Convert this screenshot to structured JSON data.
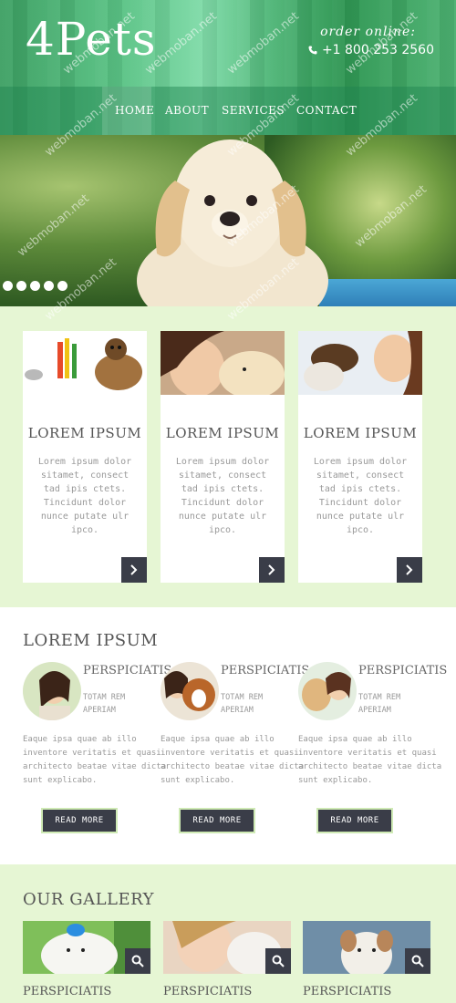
{
  "header": {
    "logo": "4Pets",
    "order_label": "order online:",
    "phone": "+1 800 253 2560"
  },
  "nav": {
    "items": [
      {
        "label": "HOME"
      },
      {
        "label": "ABOUT"
      },
      {
        "label": "SERVICES"
      },
      {
        "label": "CONTACT"
      }
    ],
    "active": "HOME"
  },
  "hero": {
    "slide_count": 5
  },
  "features": {
    "cards": [
      {
        "title": "LOREM IPSUM",
        "desc": "Lorem ipsum dolor sitamet, consect tad ipis ctets. Tincidunt dolor nunce putate ulr ipco."
      },
      {
        "title": "LOREM IPSUM",
        "desc": "Lorem ipsum dolor sitamet, consect tad ipis ctets. Tincidunt dolor nunce putate ulr ipco."
      },
      {
        "title": "LOREM IPSUM",
        "desc": "Lorem ipsum dolor sitamet, consect tad ipis ctets. Tincidunt dolor nunce putate ulr ipco."
      }
    ]
  },
  "about": {
    "title": "LOREM IPSUM",
    "people": [
      {
        "title": "PERSPICIATIS",
        "sub": "TOTAM REM APERIAM",
        "desc": "Eaque ipsa quae ab illo inventore veritatis et quasi architecto beatae vitae dicta sunt explicabo.",
        "button": "READ MORE"
      },
      {
        "title": "PERSPICIATIS",
        "sub": "TOTAM REM APERIAM",
        "desc": "Eaque ipsa quae ab illo inventore veritatis et quasi architecto beatae vitae dicta sunt explicabo.",
        "button": "READ MORE"
      },
      {
        "title": "PERSPICIATIS",
        "sub": "TOTAM REM APERIAM",
        "desc": "Eaque ipsa quae ab illo inventore veritatis et quasi architecto beatae vitae dicta sunt explicabo.",
        "button": "READ MORE"
      }
    ]
  },
  "gallery": {
    "title": "OUR GALLERY",
    "items": [
      {
        "caption": "PERSPICIATIS"
      },
      {
        "caption": "PERSPICIATIS"
      },
      {
        "caption": "PERSPICIATIS"
      }
    ]
  },
  "watermark": "webmoban.net",
  "colors": {
    "header_green": "#4db272",
    "page_bg": "#e6f6d4",
    "dark_button": "#3a3d48"
  }
}
